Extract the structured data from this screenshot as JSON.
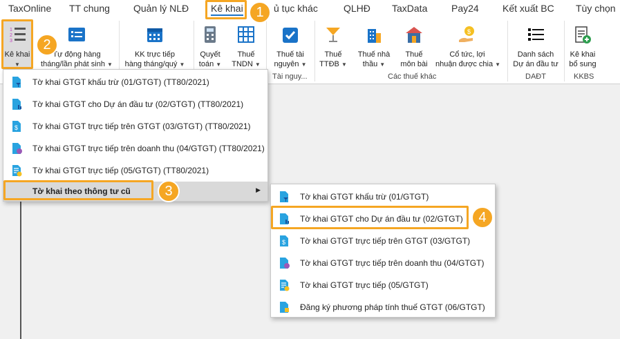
{
  "menubar": {
    "tabs": [
      {
        "label": "TaxOnline"
      },
      {
        "label": "TT chung"
      },
      {
        "label": "Quản lý NLĐ"
      },
      {
        "label": "Kê khai"
      },
      {
        "label": "ủ tục khác"
      },
      {
        "label": "QLHĐ"
      },
      {
        "label": "TaxData"
      },
      {
        "label": "Pay24"
      },
      {
        "label": "Kết xuất BC"
      },
      {
        "label": "Tùy chọn"
      }
    ]
  },
  "ribbon": {
    "buttons": [
      {
        "label": "Kê khai"
      },
      {
        "line1": "Tự động hàng",
        "line2": "tháng/lần phát sinh"
      },
      {
        "line1": "KK trực tiếp",
        "line2": "hàng tháng/quý"
      },
      {
        "line1": "Quyết",
        "line2": "toán"
      },
      {
        "line1": "Thuế",
        "line2": "TNDN"
      },
      {
        "line1": "Thuế tài",
        "line2": "nguyên"
      },
      {
        "line1": "Thuế",
        "line2": "TTĐB"
      },
      {
        "line1": "Thuế nhà",
        "line2": "thầu"
      },
      {
        "line1": "Thuế",
        "line2": "môn bài"
      },
      {
        "line1": "Cổ tức, lợi",
        "line2": "nhuận được chia"
      },
      {
        "line1": "Danh sách",
        "line2": "Dự án đầu tư"
      },
      {
        "line1": "Kê khai",
        "line2": "bổ sung"
      }
    ],
    "groups": {
      "tai": "Tài nguy...",
      "cac": "Các thuế khác",
      "daot": "DAĐT",
      "kkbs": "KKBS"
    }
  },
  "menu1": {
    "items": [
      {
        "label": "Tờ khai GTGT khấu trừ (01/GTGT) (TT80/2021)"
      },
      {
        "label": "Tờ khai GTGT cho Dự án đầu tư (02/GTGT) (TT80/2021)"
      },
      {
        "label": "Tờ khai GTGT trực tiếp trên GTGT (03/GTGT) (TT80/2021)"
      },
      {
        "label": "Tờ khai GTGT trực tiếp trên doanh thu (04/GTGT) (TT80/2021)"
      },
      {
        "label": "Tờ khai GTGT trực tiếp (05/GTGT) (TT80/2021)"
      },
      {
        "label": "Tờ khai theo thông tư cũ"
      }
    ]
  },
  "menu2": {
    "items": [
      {
        "label": "Tờ khai GTGT khấu trừ (01/GTGT)"
      },
      {
        "label": "Tờ khai GTGT cho Dự án đầu tư (02/GTGT)"
      },
      {
        "label": "Tờ khai GTGT trực tiếp trên GTGT (03/GTGT)"
      },
      {
        "label": "Tờ khai GTGT trực tiếp trên doanh thu (04/GTGT)"
      },
      {
        "label": "Tờ khai GTGT trực tiếp (05/GTGT)"
      },
      {
        "label": "Đăng ký phương pháp tính thuế GTGT (06/GTGT)"
      }
    ]
  },
  "badges": {
    "b1": "1",
    "b2": "2",
    "b3": "3",
    "b4": "4"
  },
  "colors": {
    "accent": "#f5a623",
    "tab_underline": "#1a73c8",
    "menu_hover": "#d9d9d9"
  }
}
